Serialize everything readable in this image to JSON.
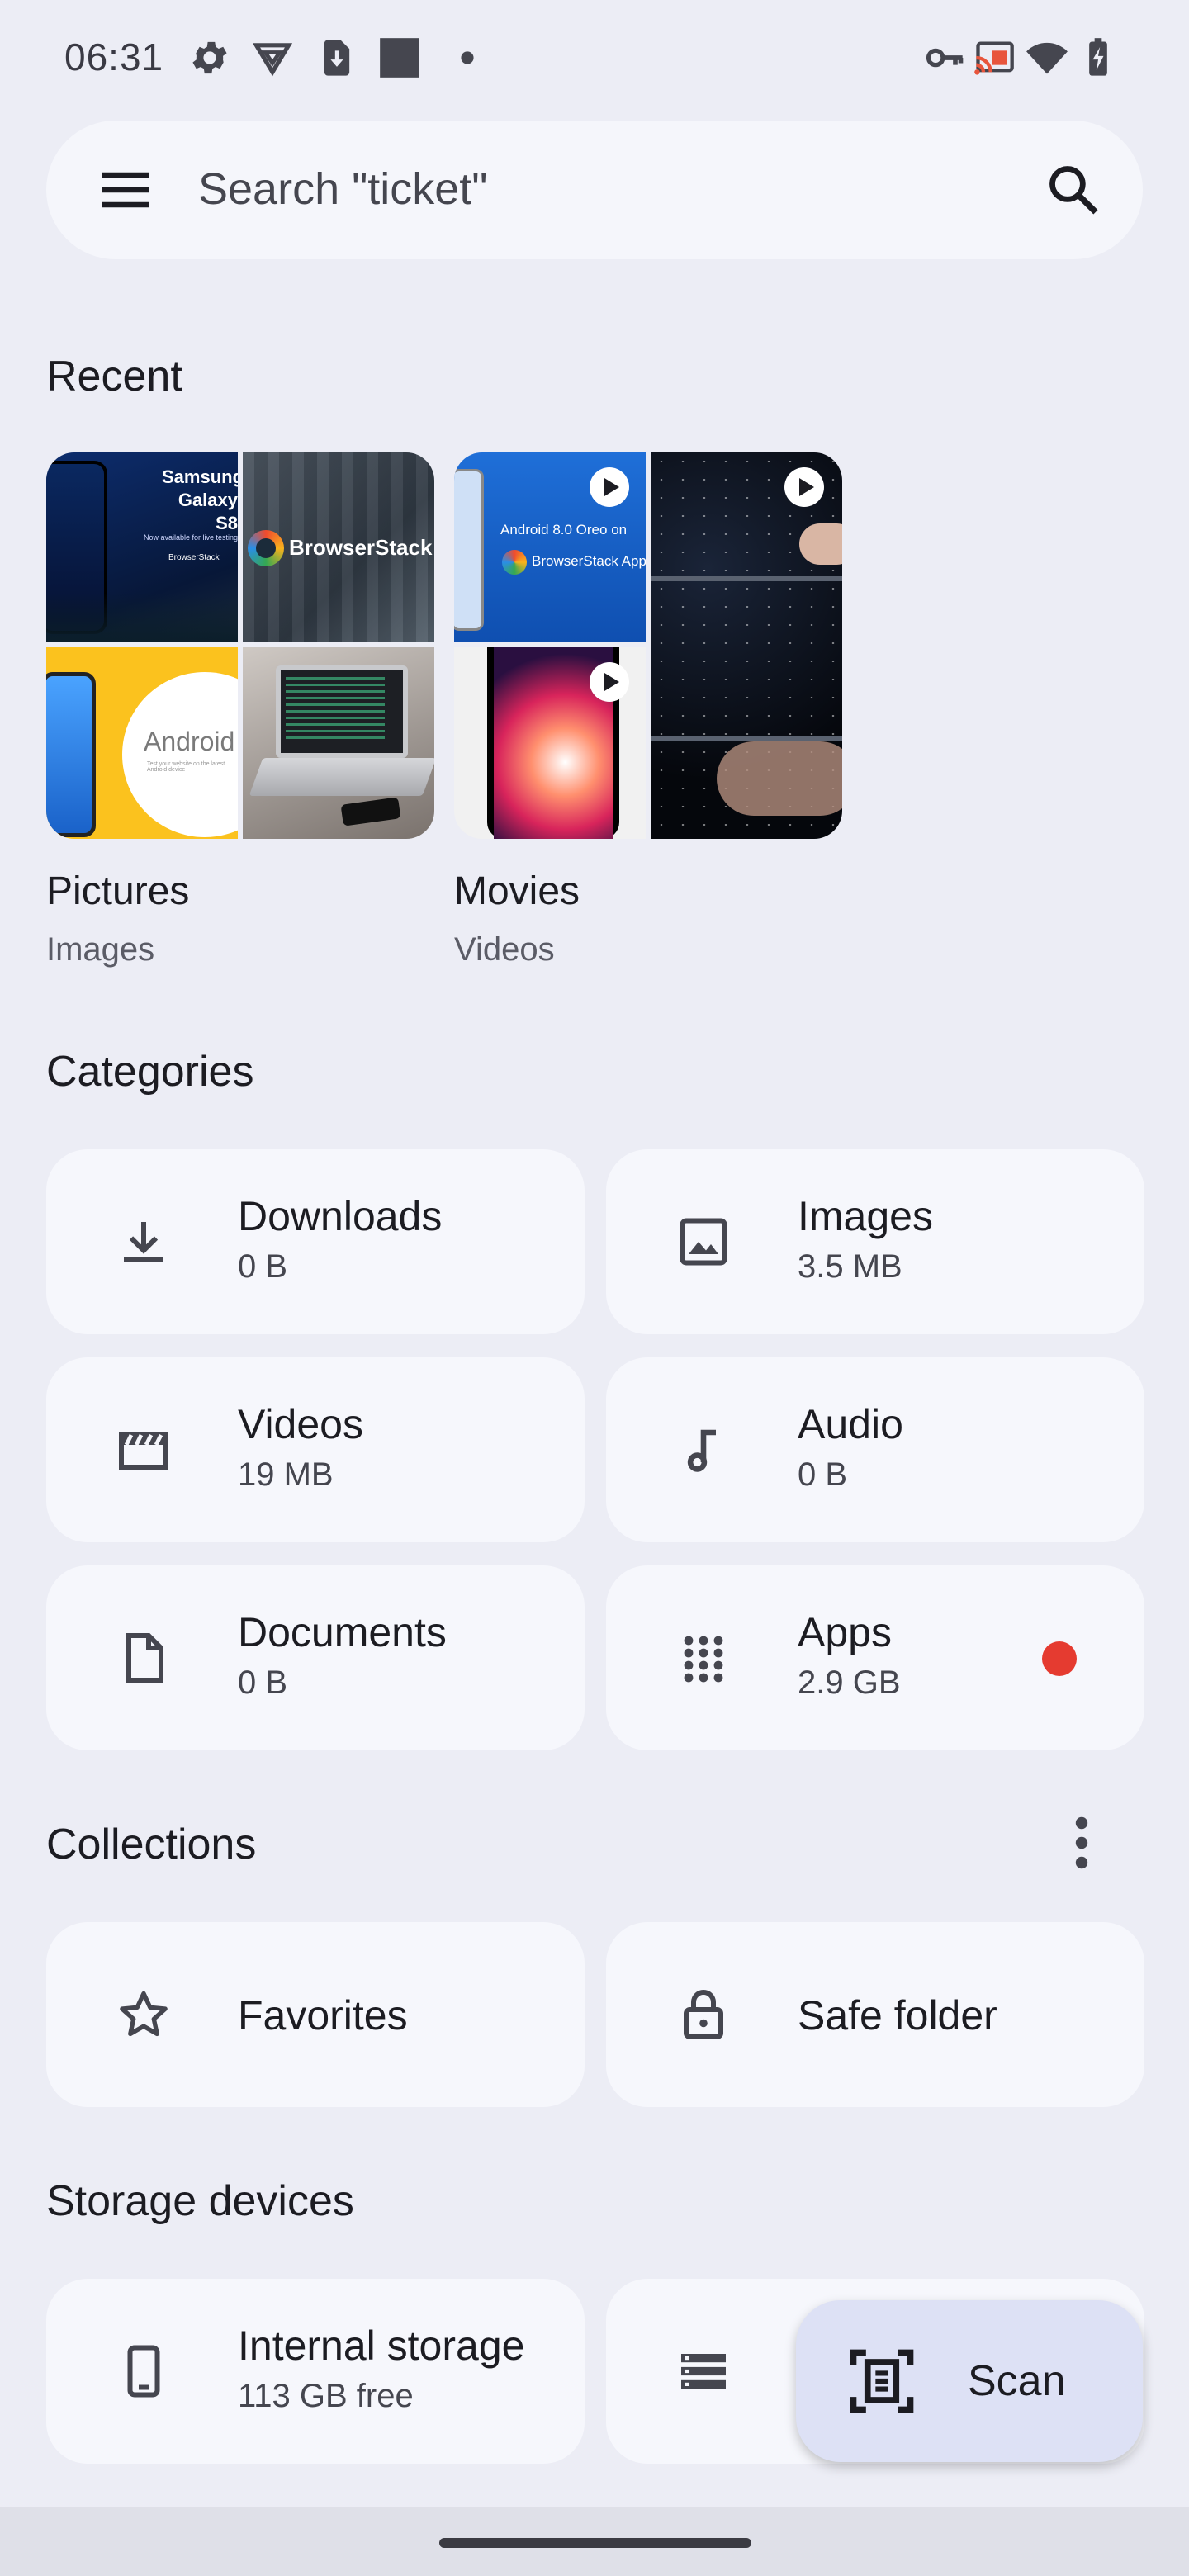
{
  "status_bar": {
    "time": "06:31",
    "left_icons": [
      "settings-icon",
      "vpn-shield-icon",
      "download-icon",
      "square-notification-icon",
      "dot-icon"
    ],
    "right_icons": [
      "key-icon",
      "cast-icon",
      "wifi-icon",
      "battery-icon"
    ]
  },
  "search": {
    "placeholder": "Search \"ticket\"",
    "menu_icon": "hamburger-menu-icon",
    "search_icon": "magnifier-icon"
  },
  "recent": {
    "title": "Recent",
    "items": [
      {
        "label": "Pictures",
        "sublabel": "Images",
        "thumb_text": [
          "Samsung",
          "Galaxy S8",
          "Now available for live testing",
          "BrowserStack",
          "BrowserStack",
          "Android O",
          "Test your website on the latest Android device"
        ]
      },
      {
        "label": "Movies",
        "sublabel": "Videos",
        "thumb_text": [
          "Android 8.0 Oreo on",
          "BrowserStack App Live"
        ]
      }
    ]
  },
  "categories": {
    "title": "Categories",
    "items": [
      {
        "name": "Downloads",
        "size": "0 B",
        "icon": "download-tray-icon"
      },
      {
        "name": "Images",
        "size": "3.5 MB",
        "icon": "image-icon"
      },
      {
        "name": "Videos",
        "size": "19 MB",
        "icon": "clapperboard-icon"
      },
      {
        "name": "Audio",
        "size": "0 B",
        "icon": "music-note-icon"
      },
      {
        "name": "Documents",
        "size": "0 B",
        "icon": "document-icon"
      },
      {
        "name": "Apps",
        "size": "2.9 GB",
        "icon": "apps-grid-icon",
        "badge_color": "#e53b30"
      }
    ]
  },
  "collections": {
    "title": "Collections",
    "more_icon": "more-vert-icon",
    "items": [
      {
        "name": "Favorites",
        "icon": "star-icon"
      },
      {
        "name": "Safe folder",
        "icon": "lock-icon"
      }
    ]
  },
  "storage": {
    "title": "Storage devices",
    "items": [
      {
        "name": "Internal storage",
        "free": "113 GB free",
        "icon": "phone-icon"
      },
      {
        "name": "",
        "free": "",
        "icon": "storage-list-icon"
      }
    ]
  },
  "fab": {
    "label": "Scan",
    "icon": "document-scan-icon"
  },
  "colors": {
    "background": "#ecedf5",
    "tile": "#f6f7fc",
    "fab": "#dde1f5",
    "badge": "#e53b30"
  }
}
